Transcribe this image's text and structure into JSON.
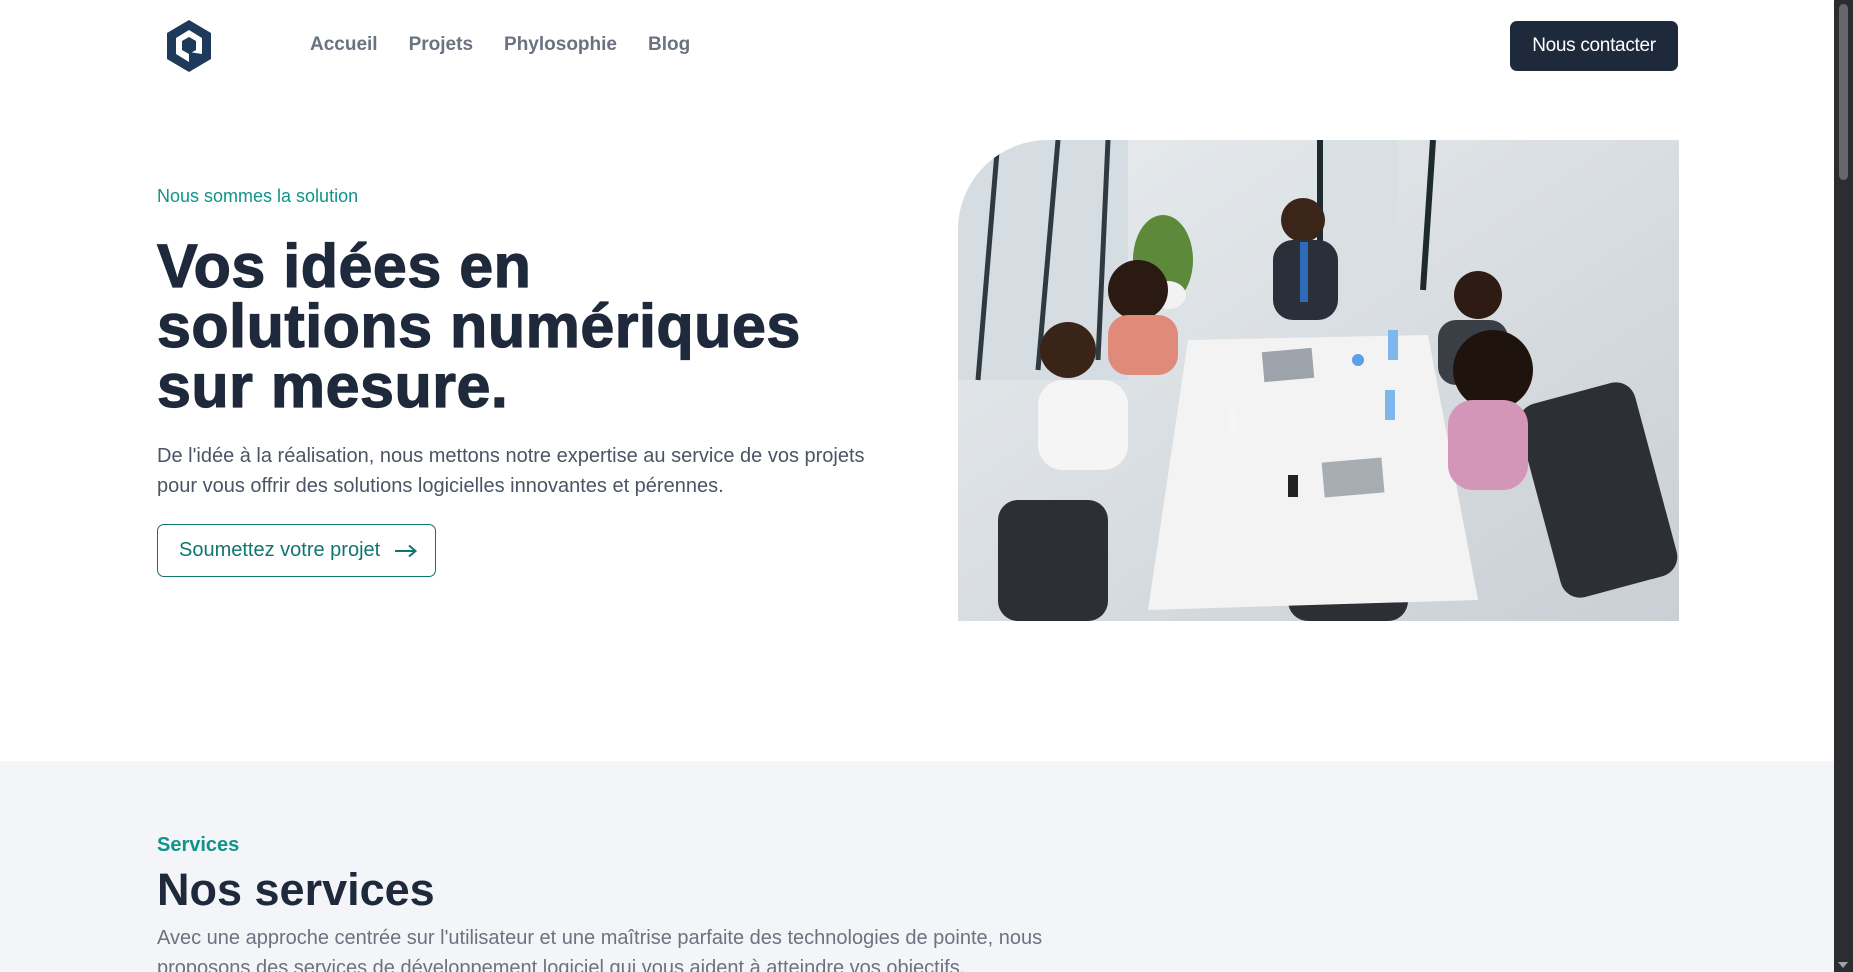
{
  "brand": {
    "logo_icon": "hexagon-logo-icon",
    "color": "#1e293b"
  },
  "nav": {
    "items": [
      {
        "label": "Accueil"
      },
      {
        "label": "Projets"
      },
      {
        "label": "Phylosophie"
      },
      {
        "label": "Blog"
      }
    ],
    "cta_label": "Nous contacter"
  },
  "hero": {
    "eyebrow": "Nous sommes la solution",
    "title_lines": [
      "Vos idées en",
      "solutions numériques",
      "sur mesure."
    ],
    "text": "De l'idée à la réalisation, nous mettons notre expertise au service de vos projets pour vous offrir des solutions logicielles innovantes et pérennes.",
    "cta_label": "Soumettez votre projet",
    "cta_icon": "arrow-right-icon",
    "image_alt": "team-meeting-photo"
  },
  "services": {
    "eyebrow": "Services",
    "title": "Nos services",
    "text": "Avec une approche centrée sur l'utilisateur et une maîtrise parfaite des technologies de pointe, nous proposons des services de développement logiciel qui vous aident à atteindre vos objectifs."
  },
  "colors": {
    "accent": "#0f9488",
    "dark": "#1e293b",
    "muted": "#6b7280",
    "section_bg": "#f3f5f8"
  }
}
